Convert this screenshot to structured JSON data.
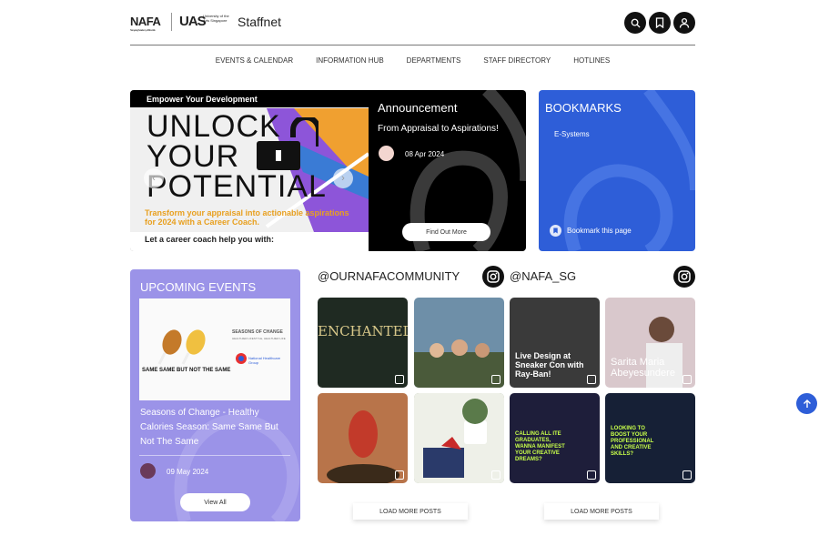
{
  "header": {
    "nafa_logo": "NAFA",
    "nafa_sub": "Nanyang Academy of Fine Arts",
    "uas_logo": "UAS",
    "uas_sub": "University of the Arts Singapore",
    "site_name": "Staffnet"
  },
  "nav": [
    "EVENTS & CALENDAR",
    "INFORMATION HUB",
    "DEPARTMENTS",
    "STAFF DIRECTORY",
    "HOTLINES"
  ],
  "banner": {
    "top_label": "Empower Your Development",
    "unlock_l1": "UNLOCK",
    "unlock_l2": "YOUR",
    "unlock_l3": "POTENTIAL",
    "tagline": "Transform your appraisal into actionable aspirations for 2024 with a Career Coach.",
    "footer": "Let a career coach help you with:",
    "prev": "‹",
    "next": "›"
  },
  "announcement": {
    "title": "Announcement",
    "subtitle": "From Appraisal to Aspirations!",
    "date": "08 Apr 2024",
    "button": "Find Out More"
  },
  "bookmarks": {
    "title": "BOOKMARKS",
    "items": [
      "E-Systems"
    ],
    "action": "Bookmark this page"
  },
  "events": {
    "title": "UPCOMING EVENTS",
    "img_caption": "SAME SAME BUT NOT THE SAME",
    "img_label": "SEASONS OF CHANGE",
    "img_sublabel": "HEALTHIER LIFESTYLE, HEALTHIER LIFE",
    "img_org": "National Healthcare Group",
    "description": "Seasons of Change - Healthy Calories Season: Same Same But Not The Same",
    "date": "09 May 2024",
    "button": "View All"
  },
  "social": [
    {
      "handle": "@OURNAFACOMMUNITY",
      "load_more": "LOAD MORE POSTS",
      "posts": [
        {
          "text": "ENCHANTED",
          "bg": "#1f2a22"
        },
        {
          "text": "",
          "bg": "#6e8fa8"
        },
        {
          "text": "",
          "bg": "#b8744a"
        },
        {
          "text": "",
          "bg": "#8a9a7c"
        }
      ]
    },
    {
      "handle": "@NAFA_SG",
      "load_more": "LOAD MORE POSTS",
      "posts": [
        {
          "text": "Live Design at Sneaker Con with Ray-Ban!",
          "bg": "#3a3a3a"
        },
        {
          "text": "Sarita Maria Abeyesundere",
          "bg": "#d9c8cc"
        },
        {
          "text": "CALLING ALL ITE GRADUATES, WANNA MANIFEST YOUR CREATIVE DREAMS?",
          "bg": "#1e1e3a"
        },
        {
          "text": "LOOKING TO BOOST YOUR PROFESSIONAL AND CREATIVE SKILLS?",
          "bg": "#162036"
        }
      ]
    }
  ],
  "colors": {
    "accent_blue": "#2e5ed8",
    "events_purple": "#9b93e8"
  }
}
